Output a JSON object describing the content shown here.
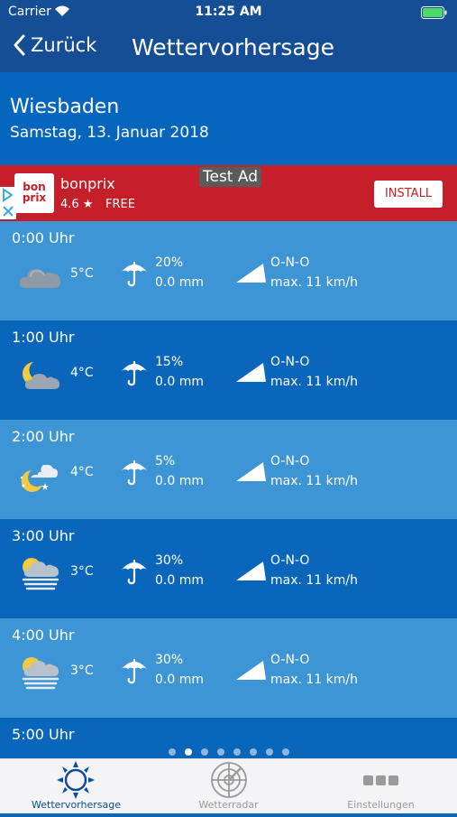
{
  "status": {
    "carrier": "Carrier",
    "time": "11:25 AM"
  },
  "nav": {
    "back_label": "Zurück",
    "title": "Wettervorhersage"
  },
  "location": {
    "city": "Wiesbaden",
    "date": "Samstag, 13. Januar 2018"
  },
  "ad": {
    "logo_top": "bon",
    "logo_bottom": "prix",
    "name": "bonprix",
    "rating": "4.6 ★",
    "price": "FREE",
    "label": "Test Ad",
    "install": "INSTALL"
  },
  "forecast": [
    {
      "hour": "0:00 Uhr",
      "icon": "cloudy-icon",
      "temp": "5°C",
      "prob": "20%",
      "mm": "0.0 mm",
      "dir": "O-N-O",
      "speed": "max. 11 km/h"
    },
    {
      "hour": "1:00 Uhr",
      "icon": "moon-cloud-icon",
      "temp": "4°C",
      "prob": "15%",
      "mm": "0.0 mm",
      "dir": "O-N-O",
      "speed": "max. 11 km/h"
    },
    {
      "hour": "2:00 Uhr",
      "icon": "moon-stars-cloud-icon",
      "temp": "4°C",
      "prob": "5%",
      "mm": "0.0 mm",
      "dir": "O-N-O",
      "speed": "max. 11 km/h"
    },
    {
      "hour": "3:00 Uhr",
      "icon": "fog-cloud-icon",
      "temp": "3°C",
      "prob": "30%",
      "mm": "0.0 mm",
      "dir": "O-N-O",
      "speed": "max. 11 km/h"
    },
    {
      "hour": "4:00 Uhr",
      "icon": "fog-cloud-icon",
      "temp": "3°C",
      "prob": "30%",
      "mm": "0.0 mm",
      "dir": "O-N-O",
      "speed": "max. 11 km/h"
    },
    {
      "hour": "5:00 Uhr"
    }
  ],
  "pager": {
    "count": 8,
    "active_index": 1
  },
  "tabs": [
    {
      "label": "Wettervorhersage",
      "icon": "sun-icon",
      "active": true
    },
    {
      "label": "Wetterradar",
      "icon": "radar-icon",
      "active": false
    },
    {
      "label": "Einstellungen",
      "icon": "more-dots-icon",
      "active": false
    }
  ],
  "colors": {
    "header": "#154e95",
    "row_light": "#3e95d6",
    "row_dark": "#0a66bb",
    "ad_red": "#c51f2a",
    "tab_active": "#0a4c9c",
    "tab_inactive": "#9a9a9a"
  }
}
